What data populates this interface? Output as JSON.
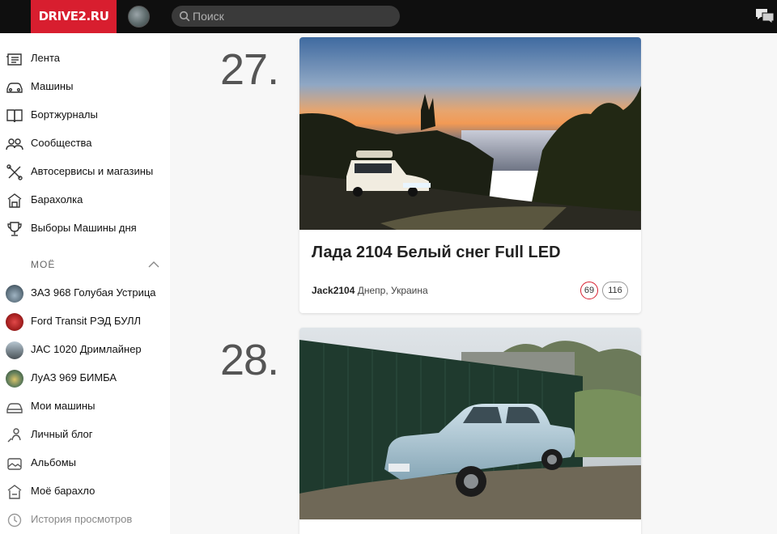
{
  "header": {
    "logo": "DRIVE2.RU",
    "search_placeholder": "Поиск"
  },
  "sidebar": {
    "items": [
      {
        "label": "Лента",
        "icon": "feed-icon"
      },
      {
        "label": "Машины",
        "icon": "car-icon"
      },
      {
        "label": "Бортжурналы",
        "icon": "logbook-icon"
      },
      {
        "label": "Сообщества",
        "icon": "communities-icon"
      },
      {
        "label": "Автосервисы и магазины",
        "icon": "tools-icon"
      },
      {
        "label": "Барахолка",
        "icon": "marketplace-icon"
      },
      {
        "label": "Выборы Машины дня",
        "icon": "trophy-icon"
      }
    ],
    "my_section": "МОЁ",
    "my_items": [
      {
        "label": "ЗАЗ 968 Голубая Устрица",
        "thumb_color": "#6a7a86"
      },
      {
        "label": "Ford Transit РЭД БУЛЛ",
        "thumb_color": "#b32a2a"
      },
      {
        "label": "JAC 1020 Дримлайнер",
        "thumb_color": "#7b8a94"
      },
      {
        "label": "ЛуАЗ 969 БИМБА",
        "thumb_color": "#4e6b52"
      }
    ],
    "more_items": [
      {
        "label": "Мои машины",
        "icon": "my-cars-icon"
      },
      {
        "label": "Личный блог",
        "icon": "blog-icon"
      },
      {
        "label": "Альбомы",
        "icon": "albums-icon"
      },
      {
        "label": "Моё барахло",
        "icon": "my-stuff-icon"
      },
      {
        "label": "История просмотров",
        "icon": "history-icon"
      }
    ]
  },
  "feed": {
    "entries": [
      {
        "rank": "27.",
        "title": "Лада 2104 Белый снег Full LED",
        "author": "Jack2104",
        "location": "Днепр, Украина",
        "likes": "69",
        "comments": "116"
      },
      {
        "rank": "28."
      }
    ]
  }
}
